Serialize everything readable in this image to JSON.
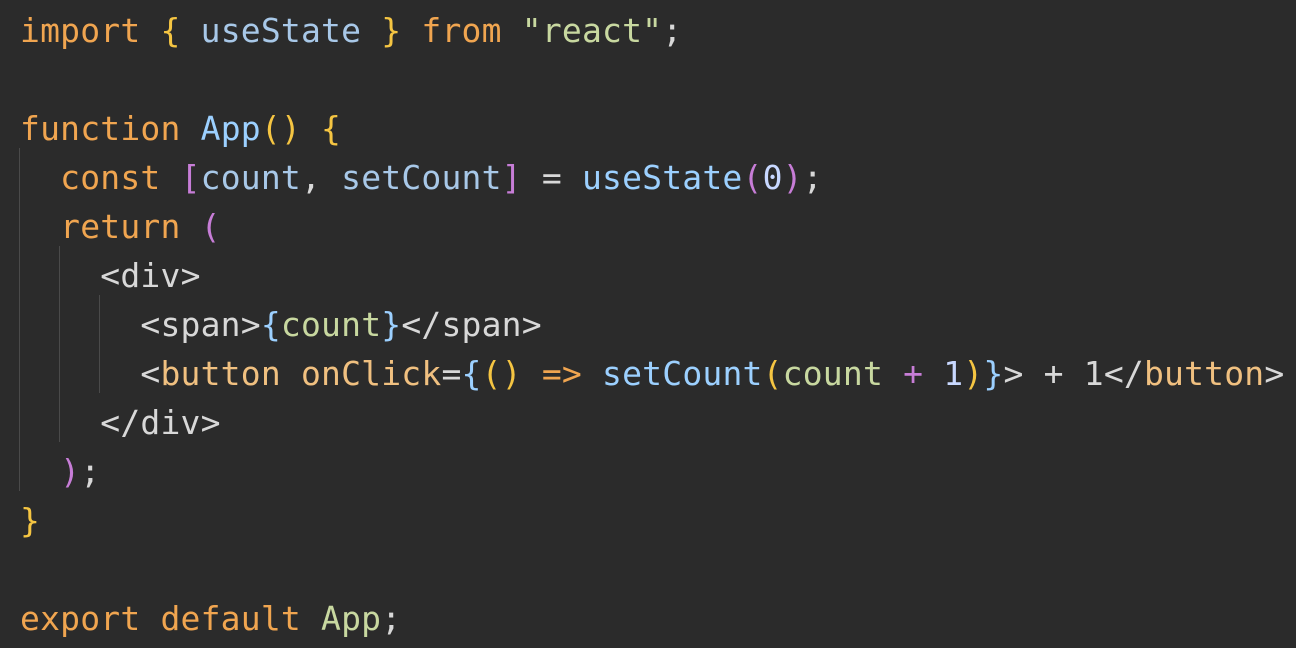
{
  "editor": {
    "background": "#2b2b2b",
    "colors": {
      "keyword": "#f0a550",
      "identifier": "#a8c8e8",
      "plain": "#d8d8d8",
      "string": "#c8d8a0",
      "brace": "#f5c542",
      "paren2": "#c77dd7",
      "funcname": "#9cd0ff",
      "number": "#c8d8ff",
      "tag": "#d8d8d8",
      "tagname": "#f0c080",
      "attr": "#f0c080"
    },
    "lines": [
      {
        "tokens": [
          {
            "t": "import",
            "c": "keyword"
          },
          {
            "t": " ",
            "c": "plain"
          },
          {
            "t": "{",
            "c": "brace"
          },
          {
            "t": " ",
            "c": "plain"
          },
          {
            "t": "useState",
            "c": "identifier"
          },
          {
            "t": " ",
            "c": "plain"
          },
          {
            "t": "}",
            "c": "brace"
          },
          {
            "t": " ",
            "c": "plain"
          },
          {
            "t": "from",
            "c": "keyword"
          },
          {
            "t": " ",
            "c": "plain"
          },
          {
            "t": "\"react\"",
            "c": "string"
          },
          {
            "t": ";",
            "c": "plain"
          }
        ]
      },
      {
        "tokens": []
      },
      {
        "tokens": [
          {
            "t": "function",
            "c": "keyword"
          },
          {
            "t": " ",
            "c": "plain"
          },
          {
            "t": "App",
            "c": "funcname"
          },
          {
            "t": "()",
            "c": "brace"
          },
          {
            "t": " ",
            "c": "plain"
          },
          {
            "t": "{",
            "c": "brace"
          }
        ]
      },
      {
        "tokens": [
          {
            "t": "  ",
            "c": "plain"
          },
          {
            "t": "const",
            "c": "keyword"
          },
          {
            "t": " ",
            "c": "plain"
          },
          {
            "t": "[",
            "c": "paren2"
          },
          {
            "t": "count",
            "c": "identifier"
          },
          {
            "t": ", ",
            "c": "plain"
          },
          {
            "t": "setCount",
            "c": "identifier"
          },
          {
            "t": "]",
            "c": "paren2"
          },
          {
            "t": " = ",
            "c": "plain"
          },
          {
            "t": "useState",
            "c": "funcname"
          },
          {
            "t": "(",
            "c": "paren2"
          },
          {
            "t": "0",
            "c": "number"
          },
          {
            "t": ")",
            "c": "paren2"
          },
          {
            "t": ";",
            "c": "plain"
          }
        ]
      },
      {
        "tokens": [
          {
            "t": "  ",
            "c": "plain"
          },
          {
            "t": "return",
            "c": "keyword"
          },
          {
            "t": " ",
            "c": "plain"
          },
          {
            "t": "(",
            "c": "paren2"
          }
        ]
      },
      {
        "tokens": [
          {
            "t": "    ",
            "c": "plain"
          },
          {
            "t": "<",
            "c": "tag"
          },
          {
            "t": "div",
            "c": "tag"
          },
          {
            "t": ">",
            "c": "tag"
          }
        ]
      },
      {
        "tokens": [
          {
            "t": "      ",
            "c": "plain"
          },
          {
            "t": "<",
            "c": "tag"
          },
          {
            "t": "span",
            "c": "tag"
          },
          {
            "t": ">",
            "c": "tag"
          },
          {
            "t": "{",
            "c": "funcname"
          },
          {
            "t": "count",
            "c": "string"
          },
          {
            "t": "}",
            "c": "funcname"
          },
          {
            "t": "</",
            "c": "tag"
          },
          {
            "t": "span",
            "c": "tag"
          },
          {
            "t": ">",
            "c": "tag"
          }
        ]
      },
      {
        "tokens": [
          {
            "t": "      ",
            "c": "plain"
          },
          {
            "t": "<",
            "c": "tag"
          },
          {
            "t": "button",
            "c": "tagname"
          },
          {
            "t": " ",
            "c": "plain"
          },
          {
            "t": "onClick",
            "c": "attr"
          },
          {
            "t": "=",
            "c": "plain"
          },
          {
            "t": "{",
            "c": "funcname"
          },
          {
            "t": "()",
            "c": "brace"
          },
          {
            "t": " ",
            "c": "plain"
          },
          {
            "t": "=>",
            "c": "keyword"
          },
          {
            "t": " ",
            "c": "plain"
          },
          {
            "t": "setCount",
            "c": "funcname"
          },
          {
            "t": "(",
            "c": "brace"
          },
          {
            "t": "count",
            "c": "string"
          },
          {
            "t": " + ",
            "c": "paren2"
          },
          {
            "t": "1",
            "c": "number"
          },
          {
            "t": ")",
            "c": "brace"
          },
          {
            "t": "}",
            "c": "funcname"
          },
          {
            "t": ">",
            "c": "tag"
          },
          {
            "t": " + 1",
            "c": "plain"
          },
          {
            "t": "</",
            "c": "tag"
          },
          {
            "t": "button",
            "c": "tagname"
          },
          {
            "t": ">",
            "c": "tag"
          }
        ]
      },
      {
        "tokens": [
          {
            "t": "    ",
            "c": "plain"
          },
          {
            "t": "</",
            "c": "tag"
          },
          {
            "t": "div",
            "c": "tag"
          },
          {
            "t": ">",
            "c": "tag"
          }
        ]
      },
      {
        "tokens": [
          {
            "t": "  ",
            "c": "plain"
          },
          {
            "t": ")",
            "c": "paren2"
          },
          {
            "t": ";",
            "c": "plain"
          }
        ]
      },
      {
        "tokens": [
          {
            "t": "}",
            "c": "brace"
          }
        ]
      },
      {
        "tokens": []
      },
      {
        "tokens": [
          {
            "t": "export",
            "c": "keyword"
          },
          {
            "t": " ",
            "c": "plain"
          },
          {
            "t": "default",
            "c": "keyword"
          },
          {
            "t": " ",
            "c": "plain"
          },
          {
            "t": "App",
            "c": "string"
          },
          {
            "t": ";",
            "c": "plain"
          }
        ]
      }
    ]
  }
}
